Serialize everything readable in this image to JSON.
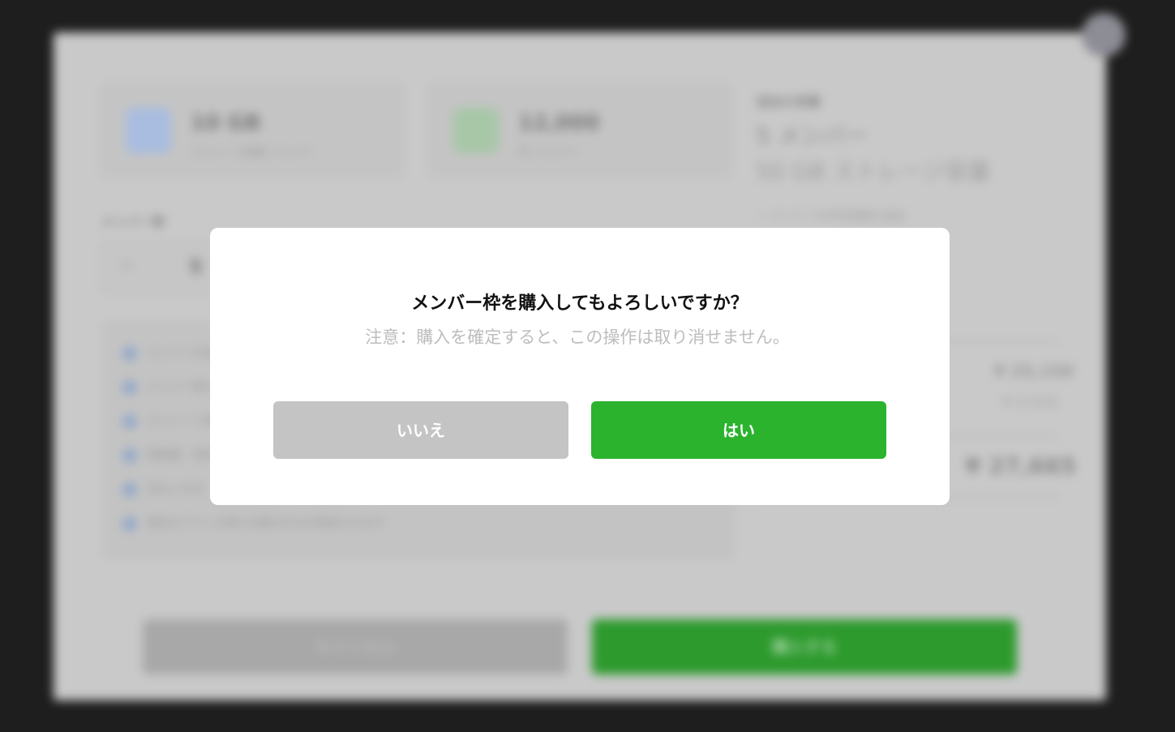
{
  "background": {
    "storage_card": {
      "value": "10 GB",
      "caption": "ストレージ容量 / メンバー",
      "icon": "storage-icon"
    },
    "price_card": {
      "value": "12,000",
      "caption": "円 / メンバー",
      "icon": "yen-icon"
    },
    "member_count_label": "メンバー数",
    "member_count_value": "5",
    "summary": {
      "header": "追加の容量",
      "line1": "5 メンバー",
      "line2": "50 GB ストレージ容量",
      "check_note": "✓ メンバーの共有容量を追加",
      "price1": "¥ 25,150",
      "price2": "¥ 2,515",
      "total": "¥ 27,665"
    },
    "features": [
      "メンバーの追加",
      "メンバー数の変更",
      "ストレージ容量",
      "明細書・領収書",
      "支払い方法",
      "現在のプランの残り日数分のみが請求されます"
    ],
    "cancel_label": "キャンセル",
    "buy_label": "購入する"
  },
  "dialog": {
    "title": "メンバー枠を購入してもよろしいですか？",
    "note": "注意：購入を確定すると、この操作は取り消せません。",
    "no_label": "いいえ",
    "yes_label": "はい"
  },
  "colors": {
    "overlay": "#1e1e1e",
    "primary": "#2bb32e",
    "secondary_button": "#c4c4c4",
    "note_text": "#bdbdbd"
  }
}
